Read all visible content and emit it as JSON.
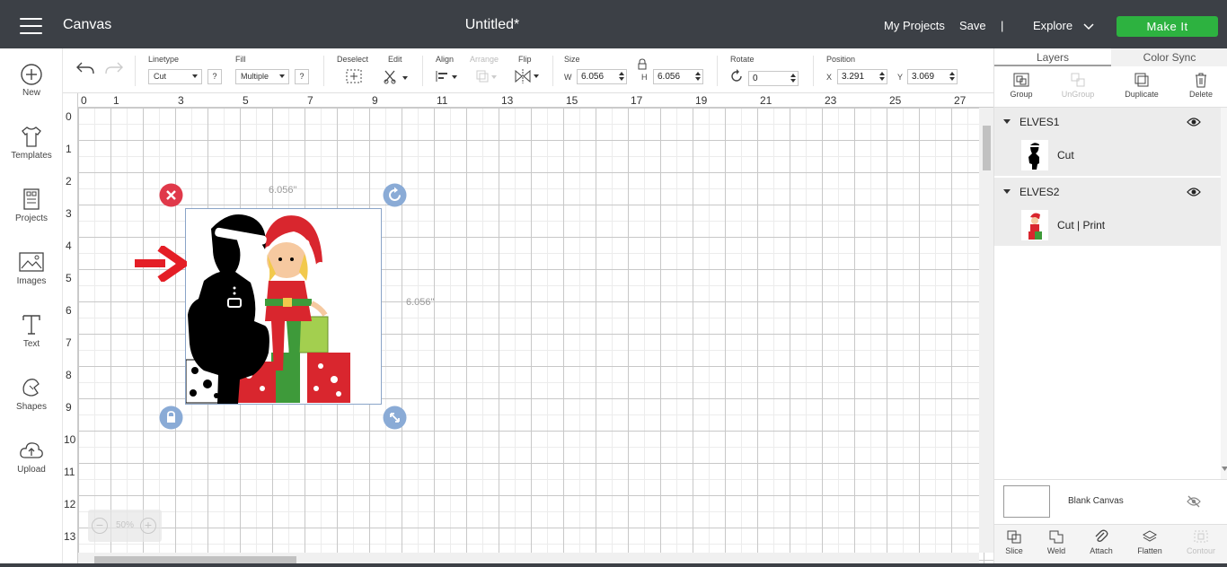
{
  "app": {
    "section": "Canvas",
    "document_title": "Untitled*"
  },
  "header": {
    "my_projects": "My Projects",
    "save": "Save",
    "separator": "|",
    "explore": "Explore",
    "make_it": "Make It"
  },
  "sidebar": {
    "items": [
      {
        "label": "New",
        "icon": "plus-circle-icon"
      },
      {
        "label": "Templates",
        "icon": "shirt-icon"
      },
      {
        "label": "Projects",
        "icon": "projects-icon"
      },
      {
        "label": "Images",
        "icon": "image-icon"
      },
      {
        "label": "Text",
        "icon": "text-icon"
      },
      {
        "label": "Shapes",
        "icon": "shapes-icon"
      },
      {
        "label": "Upload",
        "icon": "upload-cloud-icon"
      }
    ]
  },
  "toolbar": {
    "linetype_label": "Linetype",
    "linetype_value": "Cut",
    "fill_label": "Fill",
    "fill_value": "Multiple",
    "help": "?",
    "deselect": "Deselect",
    "edit": "Edit",
    "align": "Align",
    "arrange": "Arrange",
    "flip": "Flip",
    "size_label": "Size",
    "w_label": "W",
    "w_value": "6.056",
    "h_label": "H",
    "h_value": "6.056",
    "rotate_label": "Rotate",
    "rotate_value": "0",
    "position_label": "Position",
    "x_label": "X",
    "x_value": "3.291",
    "y_label": "Y",
    "y_value": "3.069"
  },
  "canvas": {
    "ruler_top": [
      "0",
      "1",
      "3",
      "5",
      "7",
      "9",
      "11",
      "13",
      "15",
      "17",
      "19",
      "21",
      "23",
      "25",
      "27"
    ],
    "ruler_left": [
      "0",
      "1",
      "2",
      "3",
      "4",
      "5",
      "6",
      "7",
      "8",
      "9",
      "10",
      "11",
      "12",
      "13"
    ],
    "width_dim": "6.056\"",
    "height_dim": "6.056\"",
    "zoom_minus": "−",
    "zoom_value": "50%",
    "zoom_plus": "+"
  },
  "right_panel": {
    "tabs": [
      "Layers",
      "Color Sync"
    ],
    "tools": [
      {
        "label": "Group",
        "enabled": true
      },
      {
        "label": "UnGroup",
        "enabled": false
      },
      {
        "label": "Duplicate",
        "enabled": true
      },
      {
        "label": "Delete",
        "enabled": true
      }
    ],
    "layers": [
      {
        "name": "ELVES1",
        "operation": "Cut"
      },
      {
        "name": "ELVES2",
        "operation": "Cut  |  Print"
      }
    ],
    "blank_canvas": "Blank Canvas",
    "bottom_tools": [
      {
        "label": "Slice",
        "enabled": true
      },
      {
        "label": "Weld",
        "enabled": true
      },
      {
        "label": "Attach",
        "enabled": true
      },
      {
        "label": "Flatten",
        "enabled": true
      },
      {
        "label": "Contour",
        "enabled": false
      }
    ]
  },
  "colors": {
    "topbar": "#3c4046",
    "make_it": "#2db240",
    "close_handle": "#e0394a",
    "handle_blue": "#8aabd6",
    "arrow": "#e41e26",
    "elf_red": "#d9262e",
    "elf_green": "#3e9a3a"
  }
}
